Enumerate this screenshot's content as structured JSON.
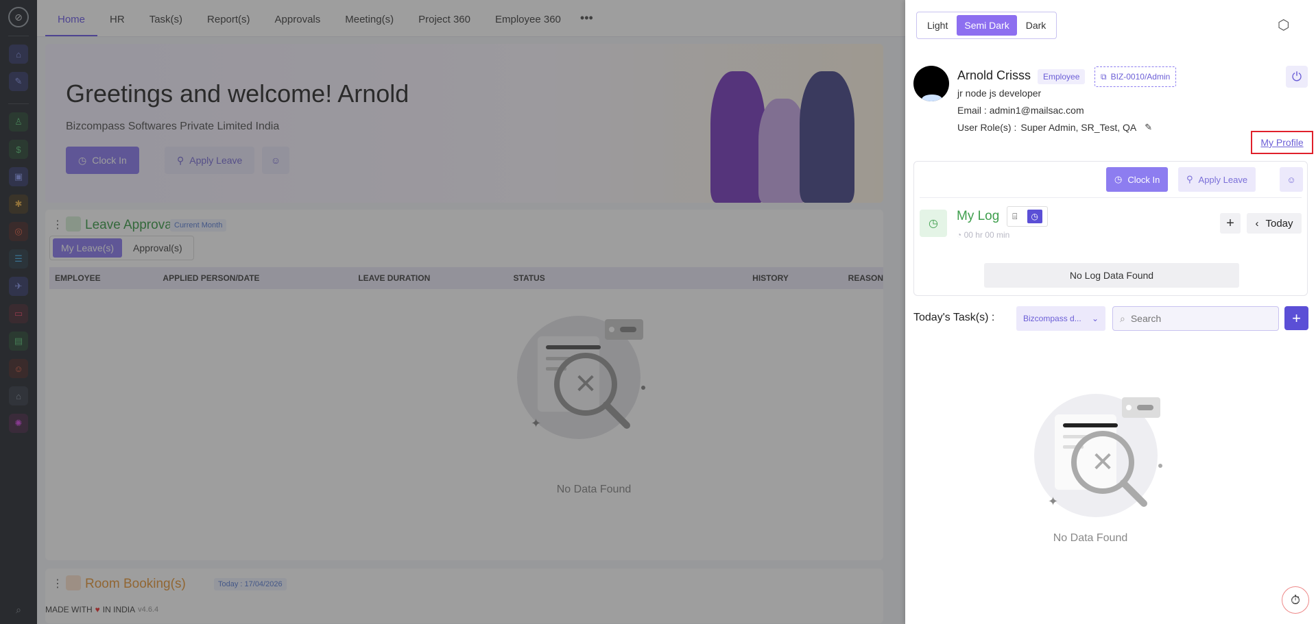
{
  "nav": {
    "tabs": [
      "Home",
      "HR",
      "Task(s)",
      "Report(s)",
      "Approvals",
      "Meeting(s)",
      "Project 360",
      "Employee 360"
    ],
    "more": "•••"
  },
  "hero": {
    "greeting": "Greetings and welcome! Arnold",
    "company": "Bizcompass Softwares Private Limited India",
    "clock_in": "Clock In",
    "apply_leave": "Apply Leave"
  },
  "leave_card": {
    "title": "Leave Approval",
    "badge": "Current Month",
    "tabs": [
      "My Leave(s)",
      "Approval(s)"
    ],
    "columns": [
      "EMPLOYEE",
      "APPLIED PERSON/DATE",
      "LEAVE DURATION",
      "STATUS",
      "HISTORY",
      "REASON"
    ],
    "empty": "No Data Found"
  },
  "room_card": {
    "title": "Room Booking(s)",
    "badge": "Today : 17/04/2026"
  },
  "footer": {
    "made_prefix": "MADE WITH",
    "made_suffix": "IN INDIA",
    "version": "v4.6.4"
  },
  "panel": {
    "theme_options": [
      "Light",
      "Semi Dark",
      "Dark"
    ],
    "theme_selected": "Semi Dark",
    "profile": {
      "name": "Arnold Crisss",
      "role_badge": "Employee",
      "code": "BIZ-0010/Admin",
      "job": "jr node js developer",
      "email_label": "Email :",
      "email": "admin1@mailsac.com",
      "roles_label": "User Role(s) :",
      "roles": "Super Admin, SR_Test, QA",
      "my_profile": "My Profile"
    },
    "log": {
      "clock_in": "Clock In",
      "apply_leave": "Apply Leave",
      "title": "My Log",
      "time": "00 hr 00 min",
      "today": "Today",
      "empty": "No Log Data Found"
    },
    "tasks": {
      "label": "Today's Task(s) :",
      "company": "Bizcompass d...",
      "search_placeholder": "Search",
      "empty": "No Data Found"
    }
  },
  "colors": {
    "accent": "#8d6ff0",
    "accent_dark": "#5b4fd6",
    "green_title": "#3e9e4c",
    "orange_title": "#e89a3c",
    "highlight_border": "#e0202a"
  }
}
